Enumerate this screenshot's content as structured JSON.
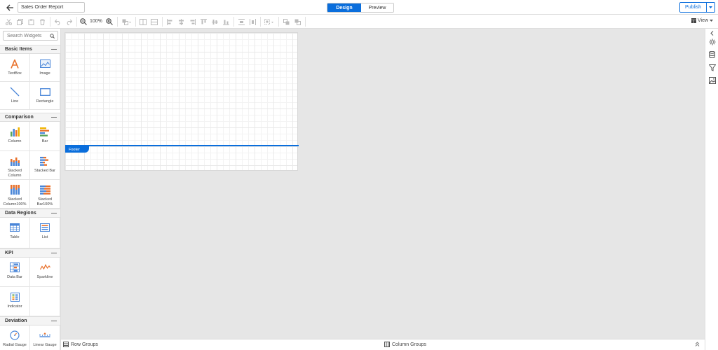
{
  "header": {
    "report_name": "Sales Order Report",
    "mode_design": "Design",
    "mode_preview": "Preview",
    "publish": "Publish"
  },
  "toolbar": {
    "zoom": "100%",
    "view": "View"
  },
  "left_panel": {
    "search_placeholder": "Search Widgets",
    "sections": [
      {
        "title": "Basic Items",
        "widgets": [
          "TextBox",
          "Image",
          "Line",
          "Rectangle"
        ]
      },
      {
        "title": "Comparison",
        "widgets": [
          "Column",
          "Bar",
          "Stacked Column",
          "Stacked Bar",
          "Stacked Column100%",
          "Stacked Bar100%"
        ]
      },
      {
        "title": "Data Regions",
        "widgets": [
          "Table",
          "List"
        ]
      },
      {
        "title": "KPI",
        "widgets": [
          "Data Bar",
          "Sparkline",
          "Indicator"
        ]
      },
      {
        "title": "Deviation",
        "widgets": [
          "Radial Gauge",
          "Linear Gauge"
        ]
      }
    ]
  },
  "canvas": {
    "footer_label": "Footer"
  },
  "bottom_bar": {
    "row_groups": "Row Groups",
    "column_groups": "Column Groups"
  },
  "colors": {
    "accent": "#0a6edc",
    "orange": "#e8702a",
    "blue": "#4a86d8",
    "green": "#5aa55a",
    "yellow": "#f0b400"
  }
}
